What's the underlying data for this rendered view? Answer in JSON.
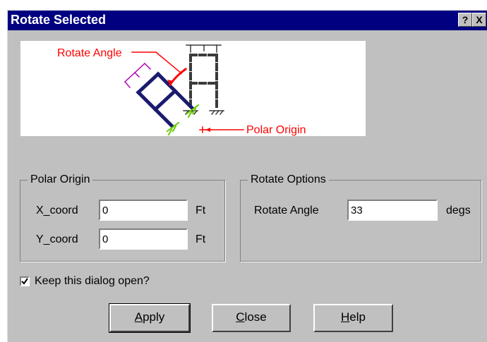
{
  "window": {
    "title": "Rotate Selected",
    "help_glyph": "?",
    "close_glyph": "X"
  },
  "preview": {
    "rotate_angle_label": "Rotate Angle",
    "polar_origin_label": "Polar Origin"
  },
  "polar_origin": {
    "legend": "Polar Origin",
    "x_label": "X_coord",
    "x_value": "0",
    "x_unit": "Ft",
    "y_label": "Y_coord",
    "y_value": "0",
    "y_unit": "Ft"
  },
  "rotate_options": {
    "legend": "Rotate Options",
    "angle_label": "Rotate Angle",
    "angle_value": "33",
    "angle_unit": "degs"
  },
  "keep_open": {
    "label": "Keep this dialog open?",
    "checked": true
  },
  "buttons": {
    "apply": {
      "mnemonic": "A",
      "rest": "pply"
    },
    "close": {
      "mnemonic": "C",
      "rest": "lose"
    },
    "help": {
      "mnemonic": "H",
      "rest": "elp"
    }
  },
  "colors": {
    "title_bg": "#000080",
    "dialog_bg": "#c0c0c0",
    "annotation": "#ff0000",
    "frame": "#1a1a6e",
    "member": "#b000b0",
    "support": "#66cc00"
  }
}
